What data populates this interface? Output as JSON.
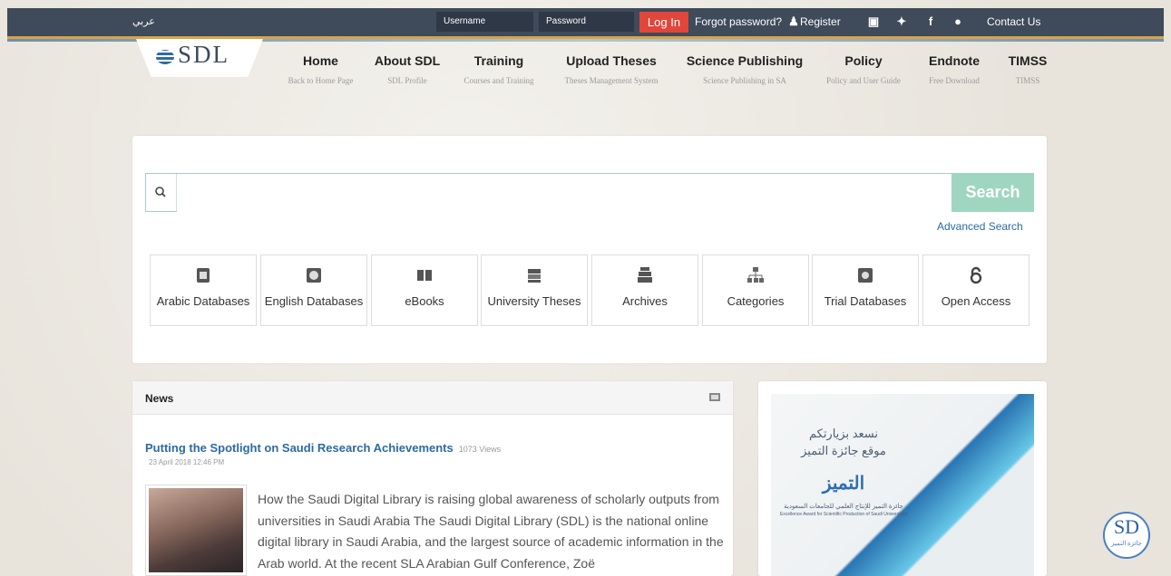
{
  "topbar": {
    "arabic": "عربي",
    "username_placeholder": "Username",
    "password_placeholder": "Password",
    "login": "Log In",
    "forgot": "Forgot password?",
    "register": "Register",
    "contact": "Contact Us",
    "social_icons": [
      "youtube-icon",
      "twitter-icon",
      "facebook-icon",
      "android-icon"
    ]
  },
  "logo": {
    "text": "SDL"
  },
  "nav": [
    {
      "title": "Home",
      "sub": "Back to Home Page"
    },
    {
      "title": "About SDL",
      "sub": "SDL Profile"
    },
    {
      "title": "Training",
      "sub": "Courses and Training"
    },
    {
      "title": "Upload Theses",
      "sub": "Theses Management System"
    },
    {
      "title": "Science Publishing",
      "sub": "Science Publishing in SA"
    },
    {
      "title": "Policy",
      "sub": "Policy and User Guide"
    },
    {
      "title": "Endnote",
      "sub": "Free Download"
    },
    {
      "title": "TIMSS",
      "sub": "TIMSS"
    }
  ],
  "search": {
    "button": "Search",
    "advanced": "Advanced Search",
    "value": ""
  },
  "tiles": [
    {
      "label": "Arabic Databases",
      "icon": "database-icon"
    },
    {
      "label": "English Databases",
      "icon": "globe-database-icon"
    },
    {
      "label": "eBooks",
      "icon": "book-icon"
    },
    {
      "label": "University Theses",
      "icon": "theses-icon"
    },
    {
      "label": "Archives",
      "icon": "archive-icon"
    },
    {
      "label": "Categories",
      "icon": "sitemap-icon"
    },
    {
      "label": "Trial Databases",
      "icon": "trial-database-icon"
    },
    {
      "label": "Open Access",
      "icon": "open-access-icon"
    }
  ],
  "news": {
    "heading": "News",
    "title": "Putting the Spotlight on Saudi Research Achievements",
    "views": "1073 Views",
    "date": "23 April 2018 12:46 PM",
    "body": "How the Saudi Digital Library is raising global awareness of scholarly outputs from universities in Saudi Arabia The Saudi Digital Library (SDL) is the national online digital library in Saudi Arabia, and the largest source of academic information in the Arab world. At the recent SLA Arabian Gulf Conference, Zoë"
  },
  "ad": {
    "line1": "نسعد بزيارتكم",
    "line2": "موقع جائزة التميز",
    "brand": "التميز",
    "line3": "جائزة التميز للإنتاج العلمي للجامعات السعودية",
    "line4": "Excellence Award for Scientific Production of Saudi Universities"
  },
  "fab": {
    "text": "SD",
    "sub": "جائزة التميز"
  },
  "colors": {
    "topbar": "#3f4a5a",
    "login": "#e1463b",
    "search_button": "#9ed6c2",
    "link": "#2b6aa3"
  }
}
